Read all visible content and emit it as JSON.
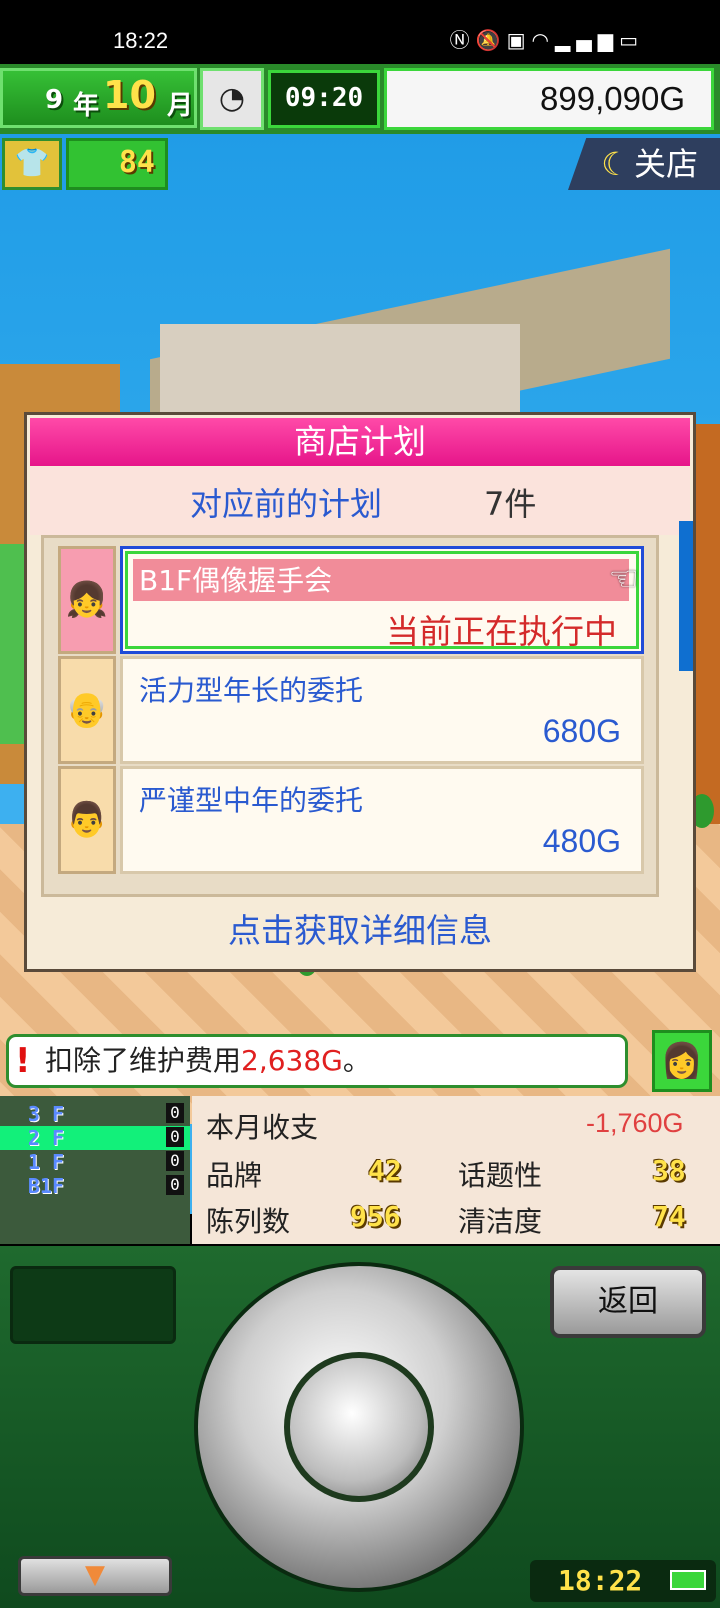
{
  "status_bar": {
    "time": "18:22",
    "icons": [
      "nfc-icon",
      "mute-icon",
      "hd-icon",
      "wifi-icon",
      "5g-signal-icon",
      "battery-icon"
    ]
  },
  "hud": {
    "year_value": "9",
    "year_unit": "年",
    "month_value": "10",
    "month_unit": "月",
    "clock_time": "09:20",
    "money": "899,090G",
    "shop_level": "84",
    "close_shop_label": "关店"
  },
  "dialog": {
    "title": "商店计划",
    "subtitle": "对应前的计划",
    "count": "7件",
    "items": [
      {
        "name": "B1F偶像握手会",
        "status": "当前正在执行中",
        "selected": true
      },
      {
        "name": "活力型年长的委托",
        "price": "680G"
      },
      {
        "name": "严谨型中年的委托",
        "price": "480G"
      }
    ],
    "footer": "点击获取详细信息"
  },
  "message": {
    "prefix": "扣除了维护费用",
    "amount": "2,638G",
    "suffix": "。"
  },
  "floors": [
    {
      "label": "3 F",
      "count": "0"
    },
    {
      "label": "2 F",
      "count": "0",
      "active": true
    },
    {
      "label": "1 F",
      "count": "0"
    },
    {
      "label": "B1F",
      "count": "0"
    }
  ],
  "stats": {
    "monthly_label": "本月收支",
    "monthly_value": "-1,760G",
    "brand_label": "品牌",
    "brand_value": "42",
    "topic_label": "话题性",
    "topic_value": "38",
    "display_label": "陈列数",
    "display_value": "956",
    "clean_label": "清洁度",
    "clean_value": "74"
  },
  "controller": {
    "back_label": "返回",
    "clock": "18:22"
  },
  "colors": {
    "accent_pink": "#e6158a",
    "accent_green": "#3bd63b",
    "link_blue": "#2a5ad0",
    "alert_red": "#d42a2a"
  }
}
